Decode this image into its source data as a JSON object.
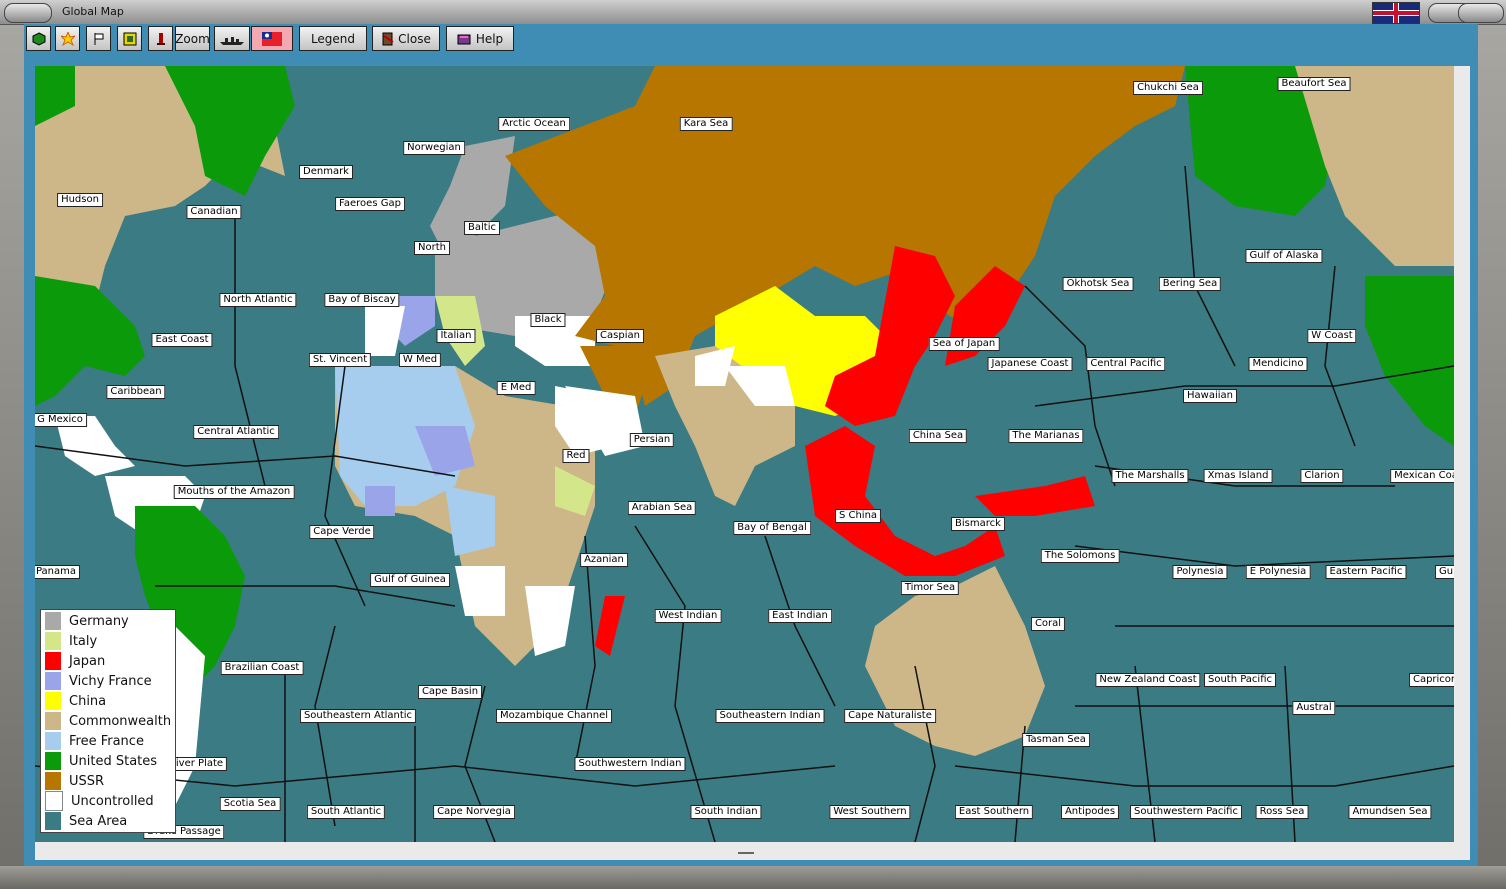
{
  "window": {
    "title": "Global Map"
  },
  "toolbar": {
    "zoom_label": "Zoom",
    "legend_label": "Legend",
    "close_label": "Close",
    "help_label": "Help"
  },
  "colors": {
    "sea": "#3b7b83",
    "germany": "#a9a9a9",
    "italy": "#d4e68a",
    "japan": "#ff0000",
    "vichy_france": "#9aa4e8",
    "china": "#ffff00",
    "commonwealth": "#cdb789",
    "free_france": "#a6cdee",
    "united_states": "#0a9a0a",
    "ussr": "#b67600",
    "uncontrolled": "#ffffff"
  },
  "legend": [
    {
      "label": "Germany",
      "color": "#a9a9a9"
    },
    {
      "label": "Italy",
      "color": "#d4e68a"
    },
    {
      "label": "Japan",
      "color": "#ff0000"
    },
    {
      "label": "Vichy France",
      "color": "#9aa4e8"
    },
    {
      "label": "China",
      "color": "#ffff00"
    },
    {
      "label": "Commonwealth",
      "color": "#cdb789"
    },
    {
      "label": "Free France",
      "color": "#a6cdee"
    },
    {
      "label": "United States",
      "color": "#0a9a0a"
    },
    {
      "label": "USSR",
      "color": "#b67600"
    },
    {
      "label": "Uncontrolled",
      "color": "#ffffff"
    },
    {
      "label": "Sea Area",
      "color": "#3b7b83"
    }
  ],
  "sea_areas": [
    "Arctic Ocean",
    "Kara Sea",
    "Chukchi Sea",
    "Beaufort Sea",
    "Norwegian",
    "Denmark",
    "Hudson",
    "Canadian",
    "Faeroes Gap",
    "Baltic",
    "North",
    "Gulf of Alaska",
    "Okhotsk Sea",
    "Bering Sea",
    "North Atlantic",
    "Bay of Biscay",
    "Black",
    "Caspian",
    "Sea of Japan",
    "W Coast",
    "East Coast",
    "Italian",
    "St. Vincent",
    "W Med",
    "Japanese Coast",
    "Central Pacific",
    "Mendicino",
    "Caribbean",
    "E Med",
    "Hawaiian",
    "G Mexico",
    "Central Atlantic",
    "Persian",
    "China Sea",
    "The Marianas",
    "Red",
    "The Marshalls",
    "Xmas Island",
    "Clarion",
    "Mexican Coa",
    "Mouths of the Amazon",
    "Arabian Sea",
    "S China",
    "Bismarck",
    "Cape Verde",
    "Bay of Bengal",
    "The Solomons",
    "Azanian",
    "Panama",
    "Gulf of Guinea",
    "Polynesia",
    "E Polynesia",
    "Eastern Pacific",
    "Gu",
    "Timor Sea",
    "West Indian",
    "East Indian",
    "Coral",
    "Brazilian Coast",
    "New Zealand Coast",
    "South Pacific",
    "Capricor",
    "Cape Basin",
    "Austral",
    "Southeastern Atlantic",
    "Mozambique Channel",
    "Southeastern Indian",
    "Cape Naturaliste",
    "Tasman Sea",
    "River Plate",
    "Southwestern Indian",
    "Scotia Sea",
    "South Atlantic",
    "Cape Norvegia",
    "South Indian",
    "West Southern",
    "East Southern",
    "Antipodes",
    "Southwestern Pacific",
    "Ross Sea",
    "Amundsen Sea",
    "Drake Passage"
  ]
}
